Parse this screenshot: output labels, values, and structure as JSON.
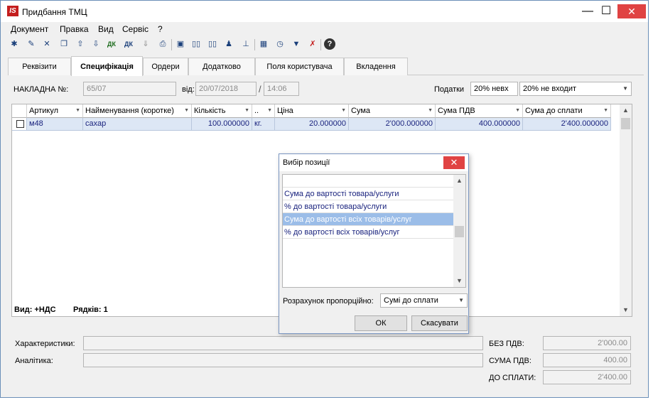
{
  "window": {
    "logo_text": "IS",
    "title": "Придбання ТМЦ",
    "minimize": "—",
    "maximize": "☐",
    "close": "✕"
  },
  "menu": [
    "Документ",
    "Правка",
    "Вид",
    "Сервіс",
    "?"
  ],
  "toolbar_icons": [
    "new-doc-icon",
    "new-copy-icon",
    "delete-doc-icon",
    "copy-icon",
    "upload-icon",
    "insert-icon",
    "dk-green-icon",
    "dk-blue-icon",
    "move-down-icon",
    "print-icon",
    "save-icon",
    "open-book-icon",
    "book-icon",
    "org-icon",
    "hierarchy-icon",
    "table-icon",
    "clock-icon",
    "filter-icon",
    "clear-filter-icon",
    "help-icon"
  ],
  "tabs": [
    "Реквізити",
    "Специфікація",
    "Ордери",
    "Додатково",
    "Поля користувача",
    "Вкладення"
  ],
  "header": {
    "invoice_label": "НАКЛАДНА №:",
    "invoice_number": "65/07",
    "date_label": "від:",
    "date": "20/07/2018",
    "slash": "/",
    "time": "14:06",
    "taxes_label": "Податки",
    "tax_mode": "20% невх",
    "tax_select": "20% не входит"
  },
  "grid": {
    "columns": [
      "Артикул",
      "Найменування (коротке)",
      "Кількість",
      "..",
      "Ціна",
      "Сума",
      "Сума ПДВ",
      "Сума до сплати"
    ],
    "rows": [
      {
        "article": "м48",
        "name": "сахар",
        "quantity": "100.000000",
        "unit": "кг.",
        "price": "20.000000",
        "sum": "2'000.000000",
        "vat": "400.000000",
        "total": "2'400.000000"
      }
    ],
    "footer_view": "Вид: +НДС",
    "footer_rows": "Рядків: 1"
  },
  "bottom": {
    "characteristics_label": "Характеристики:",
    "analytics_label": "Аналітика:",
    "no_vat_label": "БЕЗ ПДВ:",
    "no_vat_value": "2'000.00",
    "vat_label": "СУМА ПДВ:",
    "vat_value": "400.00",
    "to_pay_label": "ДО СПЛАТИ:",
    "to_pay_value": "2'400.00"
  },
  "dialog": {
    "title": "Вибір позиції",
    "items": [
      "",
      "Сума до вартості товара/услуги",
      "% до вартості товара/услуги",
      "Сума до вартості всіх товарів/услуг",
      "% до вартості всіх товарів/услуг"
    ],
    "selected_index": 3,
    "calc_label": "Розрахунок пропорційно:",
    "calc_value": "Сумі до сплати",
    "ok": "ОК",
    "cancel": "Скасувати"
  }
}
